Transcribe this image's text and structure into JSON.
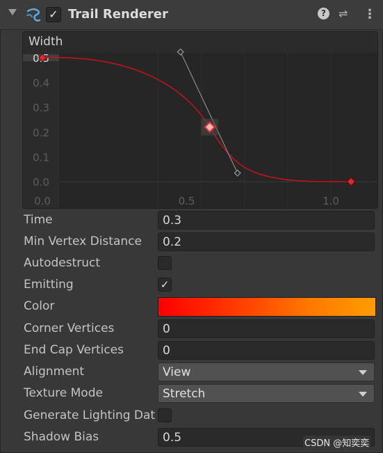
{
  "component": {
    "title": "Trail Renderer",
    "enabled_check": "✓",
    "icons": [
      "foldout-arrow-icon",
      "trail-renderer-icon",
      "help-icon",
      "preset-sliders-icon",
      "kebab-menu-icon"
    ]
  },
  "curve": {
    "label": "Width",
    "y_ticks": [
      "0.5",
      "0.4",
      "0.3",
      "0.2",
      "0.1",
      "0.0"
    ],
    "x_ticks": [
      "0.0",
      "0.5",
      "1.0"
    ],
    "keys": [
      {
        "time": 0.0,
        "value": 0.5
      },
      {
        "time": 0.58,
        "value": 0.22
      },
      {
        "time": 1.07,
        "value": 0.0
      }
    ],
    "curve_color": "#c1121c",
    "key_color": "#e02a2a"
  },
  "properties": [
    {
      "label": "Time",
      "value": "0.3"
    },
    {
      "label": "Min Vertex Distance",
      "value": "0.2"
    },
    {
      "label": "Autodestruct",
      "checked": ""
    },
    {
      "label": "Emitting",
      "checked": "✓"
    },
    {
      "label": "Color"
    },
    {
      "label": "Corner Vertices",
      "value": "0"
    },
    {
      "label": "End Cap Vertices",
      "value": "0"
    },
    {
      "label": "Alignment",
      "value": "View"
    },
    {
      "label": "Texture Mode",
      "value": "Stretch"
    },
    {
      "label": "Generate Lighting Data",
      "checked": ""
    },
    {
      "label": "Shadow Bias",
      "value": "0.5"
    }
  ],
  "color_gradient": {
    "start": "#ff0000",
    "end": "#ff9d00"
  },
  "watermark": "CSDN @知奕奕"
}
